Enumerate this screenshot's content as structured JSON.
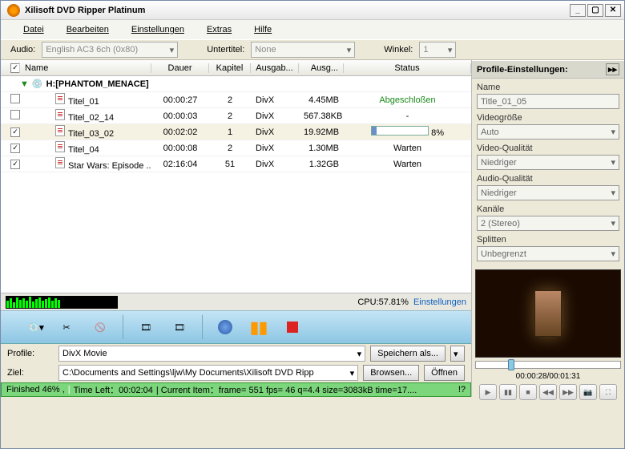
{
  "window": {
    "title": "Xilisoft DVD Ripper Platinum"
  },
  "menu": {
    "file": "Datei",
    "edit": "Bearbeiten",
    "settings": "Einstellungen",
    "extras": "Extras",
    "help": "Hilfe"
  },
  "audiobar": {
    "audio_label": "Audio:",
    "audio_value": "English AC3 6ch (0x80)",
    "sub_label": "Untertitel:",
    "sub_value": "None",
    "angle_label": "Winkel:",
    "angle_value": "1"
  },
  "columns": {
    "name": "Name",
    "duration": "Dauer",
    "chapter": "Kapitel",
    "outfmt": "Ausgab...",
    "outsize": "Ausg...",
    "status": "Status"
  },
  "disc": "H:[PHANTOM_MENACE]",
  "rows": [
    {
      "chk": false,
      "name": "Titel_01",
      "dur": "00:00:27",
      "kap": "2",
      "fmt": "DivX",
      "size": "4.45MB",
      "status": "Abgeschloßen",
      "done": true
    },
    {
      "chk": false,
      "name": "Titel_02_14",
      "dur": "00:00:03",
      "kap": "2",
      "fmt": "DivX",
      "size": "567.38KB",
      "status": "-"
    },
    {
      "chk": true,
      "name": "Titel_03_02",
      "dur": "00:02:02",
      "kap": "1",
      "fmt": "DivX",
      "size": "19.92MB",
      "status": "8%",
      "progress": 8,
      "sel": true
    },
    {
      "chk": true,
      "name": "Titel_04",
      "dur": "00:00:08",
      "kap": "2",
      "fmt": "DivX",
      "size": "1.30MB",
      "status": "Warten"
    },
    {
      "chk": true,
      "name": "Star Wars: Episode ...",
      "dur": "02:16:04",
      "kap": "51",
      "fmt": "DivX",
      "size": "1.32GB",
      "status": "Warten"
    }
  ],
  "cpu": {
    "label": "CPU:57.81%",
    "link": "Einstellungen"
  },
  "profilebar": {
    "profile_label": "Profile:",
    "profile_value": "DivX Movie",
    "saveas": "Speichern als...",
    "dest_label": "Ziel:",
    "dest_value": "C:\\Documents and Settings\\ljw\\My Documents\\Xilisoft DVD Ripp",
    "browse": "Browsen...",
    "open": "Öffnen"
  },
  "statusbar": {
    "finished": "Finished 46% ,",
    "timeleft": "Time Left：00:02:04",
    "current": "| Current Item：frame=  551 fps= 46 q=4.4 size=3083kB time=17....",
    "ext": "!?"
  },
  "panel": {
    "header": "Profile-Einstellungen:",
    "name_label": "Name",
    "name_value": "Title_01_05",
    "vsize_label": "Videogröße",
    "vsize_value": "Auto",
    "vqual_label": "Video-Qualität",
    "vqual_value": "Niedriger",
    "aqual_label": "Audio-Qualität",
    "aqual_value": "Niedriger",
    "chan_label": "Kanäle",
    "chan_value": "2 (Stereo)",
    "split_label": "Splitten",
    "split_value": "Unbegrenzt"
  },
  "preview": {
    "time": "00:00:28/00:01:31"
  }
}
